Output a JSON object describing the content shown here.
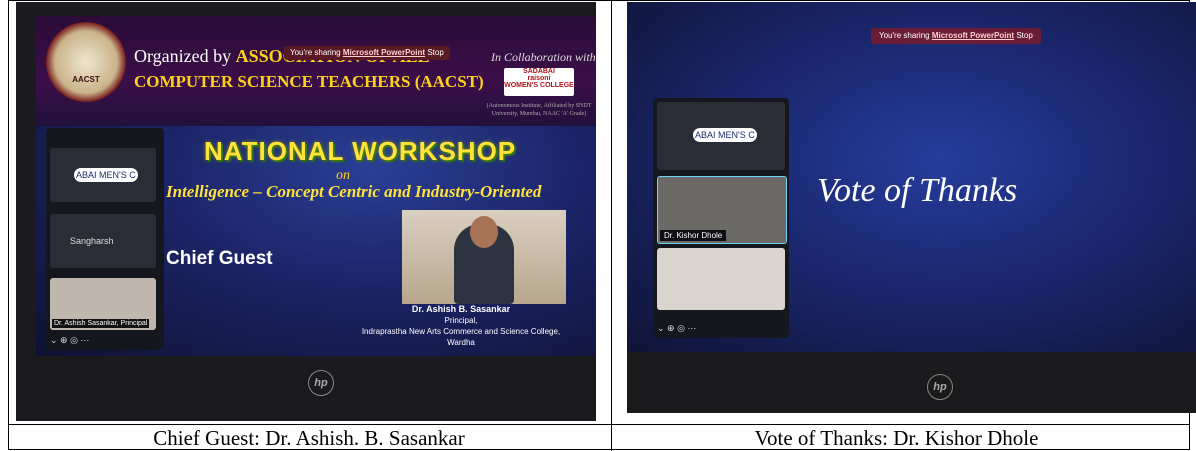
{
  "captions": {
    "left": "Chief Guest: Dr. Ashish. B. Sasankar",
    "right": "Vote of Thanks: Dr. Kishor Dhole"
  },
  "slide1": {
    "seal_text": "AACST",
    "organized_prefix": "Organized by",
    "organized_org_line1": "ASSOCIATION OF ALL",
    "organized_org_line2": "COMPUTER SCIENCE TEACHERS (AACST)",
    "collaboration": "In Collaboration with",
    "college_logo_line1": "SADABAI",
    "college_logo_line2": "raisoni",
    "college_logo_line3": "WOMEN'S COLLEGE",
    "affiliation": "(Autonomous Institute, Affiliated by SNDT University, Mumbai, NAAC 'A' Grade)",
    "sharing_text": "You're sharing",
    "sharing_app": "Microsoft PowerPoint",
    "sharing_stop": "Stop",
    "workshop_title": "NATIONAL WORKSHOP",
    "on": "on",
    "topic": "Intelligence – Concept Centric and Industry-Oriented",
    "chief_guest": "Chief Guest",
    "guest_name": "Dr. Ashish B. Sasankar",
    "guest_title": "Principal,",
    "guest_college": "Indraprastha New Arts Commerce and Science College,",
    "guest_city": "Wardha",
    "participant_tile1": "ABAI MEN'S C",
    "participant_tile2": "Sangharsh",
    "participant_tile3": "Dr. Ashish Sasankar, Principal"
  },
  "slide2": {
    "sharing_text": "You're sharing",
    "sharing_app": "Microsoft PowerPoint",
    "sharing_stop": "Stop",
    "title": "Vote of Thanks",
    "participant_tile1": "ABAI MEN'S C",
    "participant_name": "Dr. Kishor Dhole"
  },
  "colors": {
    "accent_yellow": "#ffd21a",
    "slide_blue": "#1b2466",
    "banner_purple": "#3b0f49"
  }
}
